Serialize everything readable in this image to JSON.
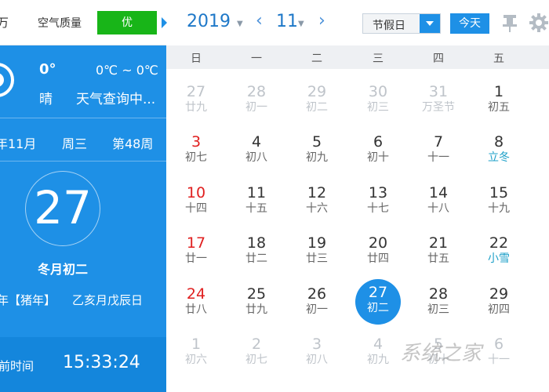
{
  "left": {
    "city": "万",
    "air_quality_label": "空气质量",
    "air_quality_value": "优",
    "temp": "0°",
    "temp_range": "0℃ ~ 0℃",
    "weather": "晴",
    "weather_status": "天气查询中...",
    "year_month": "年11月",
    "weekday": "周三",
    "week_number": "第48周",
    "big_day": "27",
    "lunar_date": "冬月初二",
    "ganzhi_year": "年【猪年】",
    "ganzhi_day": "乙亥月戊辰日",
    "time_label": "前时间",
    "time_value": "15:33:24"
  },
  "header": {
    "year": "2019",
    "month": "11",
    "holiday_select": "节假日",
    "today_button": "今天"
  },
  "weekdays": [
    "日",
    "一",
    "二",
    "三",
    "四",
    "五"
  ],
  "weeks": [
    [
      {
        "day": "27",
        "lunar": "廿九",
        "other": true
      },
      {
        "day": "28",
        "lunar": "初一",
        "other": true
      },
      {
        "day": "29",
        "lunar": "初二",
        "other": true
      },
      {
        "day": "30",
        "lunar": "初三",
        "other": true
      },
      {
        "day": "31",
        "lunar": "万圣节",
        "other": true
      },
      {
        "day": "1",
        "lunar": "初五"
      }
    ],
    [
      {
        "day": "3",
        "lunar": "初七",
        "sunday": true
      },
      {
        "day": "4",
        "lunar": "初八"
      },
      {
        "day": "5",
        "lunar": "初九"
      },
      {
        "day": "6",
        "lunar": "初十"
      },
      {
        "day": "7",
        "lunar": "十一"
      },
      {
        "day": "8",
        "lunar": "立冬",
        "term": true
      }
    ],
    [
      {
        "day": "10",
        "lunar": "十四",
        "sunday": true
      },
      {
        "day": "11",
        "lunar": "十五"
      },
      {
        "day": "12",
        "lunar": "十六"
      },
      {
        "day": "13",
        "lunar": "十七"
      },
      {
        "day": "14",
        "lunar": "十八"
      },
      {
        "day": "15",
        "lunar": "十九"
      }
    ],
    [
      {
        "day": "17",
        "lunar": "廿一",
        "sunday": true
      },
      {
        "day": "18",
        "lunar": "廿二"
      },
      {
        "day": "19",
        "lunar": "廿三"
      },
      {
        "day": "20",
        "lunar": "廿四"
      },
      {
        "day": "21",
        "lunar": "廿五"
      },
      {
        "day": "22",
        "lunar": "小雪",
        "term": true
      }
    ],
    [
      {
        "day": "24",
        "lunar": "廿八",
        "sunday": true
      },
      {
        "day": "25",
        "lunar": "廿九"
      },
      {
        "day": "26",
        "lunar": "初一"
      },
      {
        "day": "27",
        "lunar": "初二",
        "today": true
      },
      {
        "day": "28",
        "lunar": "初三"
      },
      {
        "day": "29",
        "lunar": "初四"
      }
    ],
    [
      {
        "day": "1",
        "lunar": "初六",
        "other": true
      },
      {
        "day": "2",
        "lunar": "初七",
        "other": true
      },
      {
        "day": "3",
        "lunar": "初八",
        "other": true
      },
      {
        "day": "4",
        "lunar": "初九",
        "other": true
      },
      {
        "day": "5",
        "lunar": "初十",
        "other": true
      },
      {
        "day": "6",
        "lunar": "十一",
        "other": true
      }
    ]
  ],
  "watermark": "系统之家",
  "colors": {
    "accent": "#1e90e6",
    "air_good": "#18b518",
    "sunday": "#e02020",
    "solar_term": "#1ea0c8"
  }
}
